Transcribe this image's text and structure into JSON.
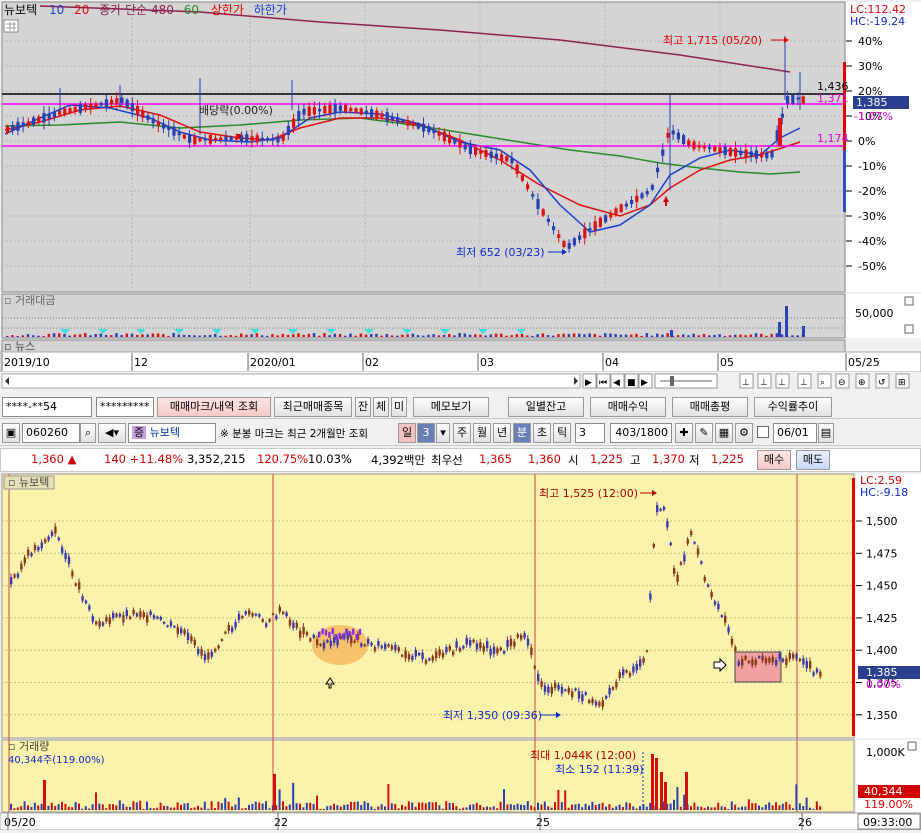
{
  "top": {
    "legend": {
      "name": "뉴보텍",
      "ma10": "10",
      "ma20": "20",
      "mainfo": "종가 단순 480",
      "ma60": "60",
      "upper": "상한가",
      "lower": "하한가"
    },
    "lc": "LC:112.42",
    "hc": "HC:-19.24",
    "pct_axis": [
      "40%",
      "30%",
      "20%",
      "10%",
      "0%",
      "-10%",
      "-20%",
      "-30%",
      "-40%",
      "-50%"
    ],
    "price_marks": {
      "p1436": "1,436",
      "p1371": "1,371",
      "p1385": "1,385",
      "pct107": "-1.07%",
      "p1174": "1,174"
    },
    "annotations": {
      "high": "최고 1,715 (05/20)",
      "low": "최저 652 (03/23)",
      "dividend": "배당락(0.00%)"
    },
    "volume_panel": {
      "title": "거래대금",
      "axis": "50,000"
    },
    "news_panel": {
      "title": "뉴스"
    },
    "dates": [
      "2019/10",
      "12",
      "2020/01",
      "02",
      "03",
      "04",
      "05",
      "05/25"
    ]
  },
  "toolbar1": {
    "account": "****-**54",
    "password": "*********",
    "b1": "매매마크/내역 조회",
    "b2": "최근매매종목",
    "b3": "잔",
    "b4": "체",
    "b5": "미",
    "b6": "메모보기",
    "b7": "일별잔고",
    "b8": "매매수익",
    "b9": "매매총평",
    "b10": "수익률추이"
  },
  "toolbar2": {
    "code": "060260",
    "name": "뉴보텍",
    "note": "※ 분봉 마크는 최근 2개월만 조회",
    "periods": [
      "일",
      "3",
      "주",
      "월",
      "년",
      "분",
      "초",
      "틱"
    ],
    "interval": "3",
    "count": "403/1800",
    "date": "06/01"
  },
  "quote": {
    "price": "1,360 ▲",
    "change": "140 +11.48%",
    "volume": "3,352,215",
    "ratio": "120.75%",
    "turnover": "10.03%",
    "amount": "4,392백만",
    "best_label": "최우선",
    "ask": "1,365",
    "bid": "1,360",
    "open_label": "시",
    "open": "1,225",
    "high_label": "고",
    "high": "1,370",
    "low_label": "저",
    "low": "1,225",
    "buy": "매수",
    "sell": "매도"
  },
  "bottom": {
    "name": "뉴보텍",
    "lc": "LC:2.59",
    "hc": "HC:-9.18",
    "price_axis": [
      "1,500",
      "1,475",
      "1,450",
      "1,425",
      "1,400",
      "1,375",
      "1,350"
    ],
    "marks": {
      "p1385": "1,385",
      "pct0": "0.00%"
    },
    "annotations": {
      "high": "최고 1,525 (12:00)",
      "low": "최저 1,350 (09:36)",
      "vmax": "최대 1,044K (12:00)",
      "vmin": "최소 152 (11:39)"
    },
    "volume": {
      "title": "거래량",
      "value": "40,344주(119.00%)",
      "axis": "1,000K",
      "mark": "40,344",
      "markpct": "119.00%"
    },
    "dates": [
      "05/20",
      "22",
      "25",
      "26"
    ],
    "time": "09:33:00"
  }
}
